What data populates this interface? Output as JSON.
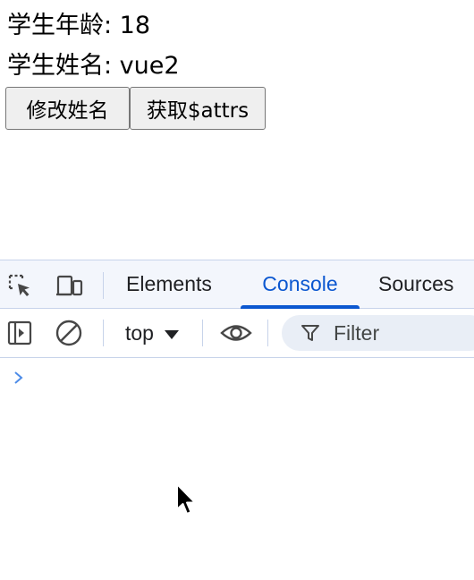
{
  "page": {
    "age_label": "学生年龄: 18",
    "name_label": "学生姓名: vue2",
    "buttons": {
      "change_name": "修改姓名",
      "get_attrs": "获取$attrs"
    }
  },
  "devtools": {
    "tabs": [
      {
        "label": "Elements",
        "active": false
      },
      {
        "label": "Console",
        "active": true
      },
      {
        "label": "Sources",
        "active": false
      }
    ],
    "toolbar": {
      "context": "top",
      "filter_placeholder": "Filter"
    },
    "icons": {
      "inspect": "inspect-element-icon",
      "device": "device-toolbar-icon",
      "sidebar": "show-sidebar-icon",
      "clear": "clear-console-icon",
      "eye": "live-expression-icon",
      "filter": "filter-icon",
      "prompt": "chevron-right-icon"
    },
    "colors": {
      "accent": "#0b57d0",
      "tabbar_bg": "#f3f6fc",
      "border": "#c7d3ea",
      "filter_bg": "#e9eef6",
      "prompt": "#4d8ce8"
    }
  }
}
